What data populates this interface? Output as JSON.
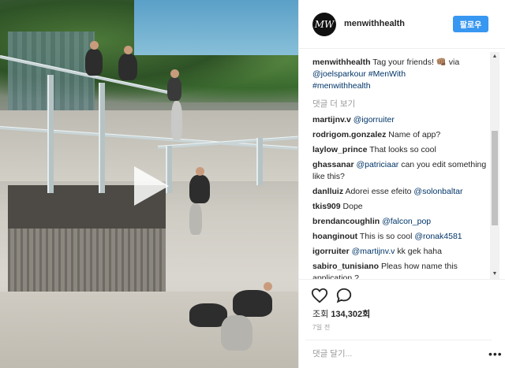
{
  "post": {
    "username": "menwithhealth",
    "avatar_text": "MW",
    "follow_label": "팔로우",
    "caption_user": "menwithhealth",
    "caption_text": "Tag your friends! 👊🏽 via",
    "caption_mention": "@joelsparkour",
    "caption_tag1": "#MenWith",
    "caption_tag2": "#menwithhealth",
    "more_comments": "댓글 더 보기",
    "views_label": "조회",
    "views_count": "134,302회",
    "time_ago": "7일 전",
    "add_comment_placeholder": "댓글 달기...",
    "more_dots": "•••"
  },
  "comments": [
    {
      "user": "martijnv.v",
      "mention": "@igorruiter",
      "text": ""
    },
    {
      "user": "rodrigom.gonzalez",
      "mention": "",
      "text": "Name of app?"
    },
    {
      "user": "laylow_prince",
      "mention": "",
      "text": "That looks so cool"
    },
    {
      "user": "ghassanar",
      "mention": "@patriciaar",
      "text": "can you edit something like this?"
    },
    {
      "user": "danlluiz",
      "mention": "",
      "text": "Adorei esse efeito",
      "mention_after": "@solonbaltar"
    },
    {
      "user": "tkis909",
      "mention": "",
      "text": "Dope"
    },
    {
      "user": "brendancoughlin",
      "mention": "@falcon_pop",
      "text": ""
    },
    {
      "user": "hoanginout",
      "mention": "",
      "text": "This is so cool",
      "mention_after": "@ronak4581"
    },
    {
      "user": "igorruiter",
      "mention": "@martijnv.v",
      "text": "kk gek haha"
    },
    {
      "user": "sabiro_tunisiano",
      "mention": "",
      "text": "Pleas how name this application ?"
    }
  ],
  "icons": {
    "heart": "heart-outline-icon",
    "comment": "speech-bubble-icon",
    "play": "play-icon"
  }
}
